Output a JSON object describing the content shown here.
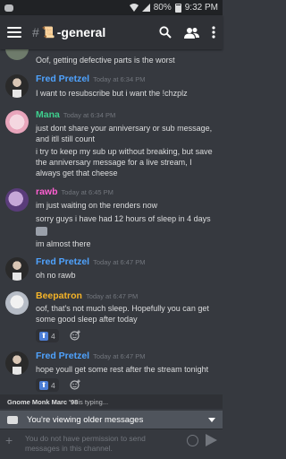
{
  "status_bar": {
    "battery": "80%",
    "time": "9:32 PM"
  },
  "header": {
    "hash": "#",
    "channel_emoji": "📜",
    "title": "-general"
  },
  "colors": {
    "fred": "#4fa3ff",
    "mana": "#3ecf8e",
    "rawb": "#ff5fd2",
    "beep": "#f5b428"
  },
  "messages": [
    {
      "text": "Oof, getting defective parts is the worst"
    },
    {
      "user": "Fred Pretzel",
      "time": "Today at 6:34 PM",
      "lines": [
        "I want to resubscribe but i want the !chzplz"
      ]
    },
    {
      "user": "Mana",
      "time": "Today at 6:34 PM",
      "lines": [
        "just dont share your anniversary or sub message, and itll still count",
        "i try to keep my sub up without breaking, but save the anniversary message for a live stream, I always get that cheese"
      ]
    },
    {
      "user": "rawb",
      "time": "Today at 6:45 PM",
      "lines": [
        "im just waiting on the renders now",
        "sorry guys i have had 12 hours of sleep in 4 days",
        "im almost there"
      ]
    },
    {
      "user": "Fred Pretzel",
      "time": "Today at 6:47 PM",
      "lines": [
        "oh no rawb"
      ]
    },
    {
      "user": "Beepatron",
      "time": "Today at 6:47 PM",
      "lines": [
        "oof, that's not much sleep. Hopefully you can get some good sleep after today"
      ],
      "reaction": {
        "emoji": "⬆",
        "count": "4"
      }
    },
    {
      "user": "Fred Pretzel",
      "time": "Today at 6:47 PM",
      "lines": [
        "hope youll get some rest after the stream tonight"
      ],
      "reaction": {
        "emoji": "⬆",
        "count": "4"
      }
    }
  ],
  "typing": {
    "user": "Gnome Monk Marc '98",
    "suffix": " is typing..."
  },
  "banner": {
    "text": "You're viewing older messages"
  },
  "input": {
    "plus": "+",
    "placeholder": "You do not have permission to send messages in this channel."
  }
}
